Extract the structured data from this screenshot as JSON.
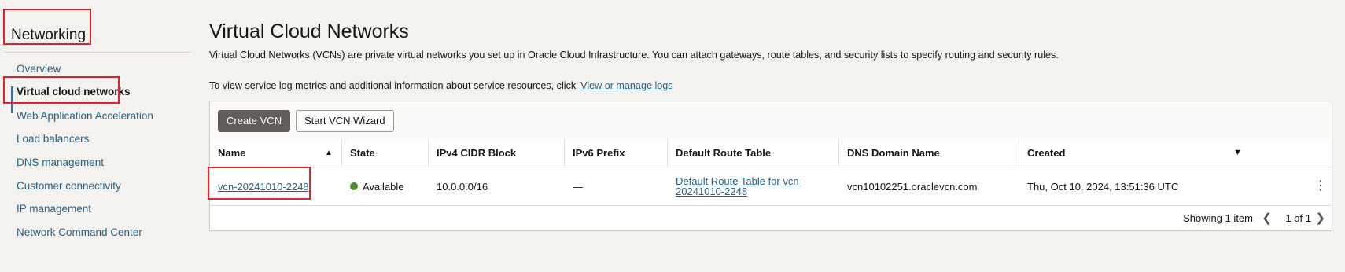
{
  "sidebar": {
    "title": "Networking",
    "items": [
      {
        "label": "Overview"
      },
      {
        "label": "Virtual cloud networks"
      },
      {
        "label": "Web Application Acceleration"
      },
      {
        "label": "Load balancers"
      },
      {
        "label": "DNS management"
      },
      {
        "label": "Customer connectivity"
      },
      {
        "label": "IP management"
      },
      {
        "label": "Network Command Center"
      }
    ],
    "active_index": 1
  },
  "main": {
    "title": "Virtual Cloud Networks",
    "description": "Virtual Cloud Networks (VCNs) are private virtual networks you set up in Oracle Cloud Infrastructure. You can attach gateways, route tables, and security lists to specify routing and security rules.",
    "logs_text": "To view service log metrics and additional information about service resources, click",
    "logs_link": "View or manage logs"
  },
  "toolbar": {
    "create_label": "Create VCN",
    "wizard_label": "Start VCN Wizard"
  },
  "table": {
    "columns": [
      "Name",
      "State",
      "IPv4 CIDR Block",
      "IPv6 Prefix",
      "Default Route Table",
      "DNS Domain Name",
      "Created"
    ],
    "rows": [
      {
        "name": "vcn-20241010-2248",
        "state": "Available",
        "ipv4": "10.0.0.0/16",
        "ipv6": "—",
        "route_table": "Default Route Table for vcn-20241010-2248",
        "dns": "vcn10102251.oraclevcn.com",
        "created": "Thu, Oct 10, 2024, 13:51:36 UTC"
      }
    ]
  },
  "footer": {
    "showing": "Showing 1 item",
    "page": "1 of 1"
  },
  "icons": {
    "sort_asc": "sort-ascending-icon",
    "column_menu": "chevron-down-icon",
    "kebab": "more-actions-icon",
    "prev": "chevron-left-icon",
    "next": "chevron-right-icon"
  },
  "colors": {
    "accent_link": "#2b5e7d",
    "primary_button": "#615e59",
    "available": "#4b8a2e",
    "highlight_box": "#e0242b"
  }
}
